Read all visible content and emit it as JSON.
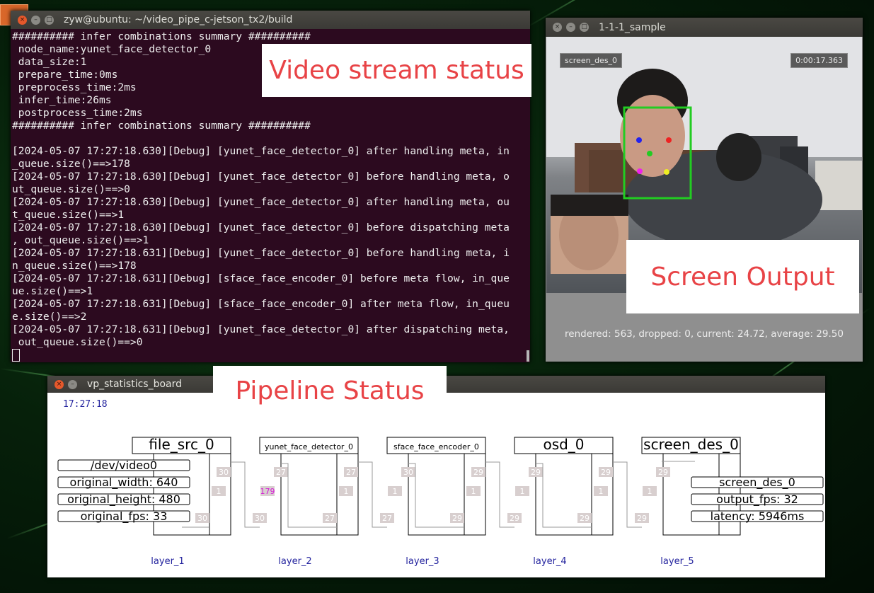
{
  "terminal": {
    "title": "zyw@ubuntu: ~/video_pipe_c-jetson_tx2/build",
    "lines": [
      "########## infer combinations summary ##########",
      " node_name:yunet_face_detector_0",
      " data_size:1",
      " prepare_time:0ms",
      " preprocess_time:2ms",
      " infer_time:26ms",
      " postprocess_time:2ms",
      "########## infer combinations summary ##########",
      "",
      "[2024-05-07 17:27:18.630][Debug] [yunet_face_detector_0] after handling meta, in",
      "_queue.size()==>178",
      "[2024-05-07 17:27:18.630][Debug] [yunet_face_detector_0] before handling meta, o",
      "ut_queue.size()==>0",
      "[2024-05-07 17:27:18.630][Debug] [yunet_face_detector_0] after handling meta, ou",
      "t_queue.size()==>1",
      "[2024-05-07 17:27:18.630][Debug] [yunet_face_detector_0] before dispatching meta",
      ", out_queue.size()==>1",
      "[2024-05-07 17:27:18.631][Debug] [yunet_face_detector_0] before handling meta, i",
      "n_queue.size()==>178",
      "[2024-05-07 17:27:18.631][Debug] [sface_face_encoder_0] before meta flow, in_que",
      "ue.size()==>1",
      "[2024-05-07 17:27:18.631][Debug] [sface_face_encoder_0] after meta flow, in_queu",
      "e.size()==>2",
      "[2024-05-07 17:27:18.631][Debug] [yunet_face_detector_0] after dispatching meta,",
      " out_queue.size()==>0"
    ]
  },
  "annotations": {
    "video_stream": "Video stream status",
    "screen_output": "Screen Output",
    "pipeline_status": "Pipeline Status"
  },
  "sample": {
    "title": "1-1-1_sample",
    "tag_left": "screen_des_0",
    "tag_right": "0:00:17.363",
    "stats": "rendered: 563, dropped: 0, current: 24.72, average: 29.50"
  },
  "board": {
    "title": "vp_statistics_board",
    "time": "17:27:18",
    "src_info": [
      "/dev/video0",
      "original_width: 640",
      "original_height: 480",
      "original_fps: 33"
    ],
    "des_info": [
      "screen_des_0",
      "output_fps: 32",
      "latency: 5946ms"
    ],
    "nodes": [
      {
        "name": "file_src_0",
        "layer": "layer_1",
        "in_val": "",
        "in_q": "",
        "out_q": "1",
        "out_val": "30",
        "out_in": "30"
      },
      {
        "name": "yunet_face_detector_0",
        "layer": "layer_2",
        "in_val": "27",
        "in_q": "179",
        "out_q": "1",
        "out_val": "27",
        "out_in": "27",
        "in_left": "30"
      },
      {
        "name": "sface_face_encoder_0",
        "layer": "layer_3",
        "in_val": "30",
        "in_q": "1",
        "out_q": "1",
        "out_val": "29",
        "out_in": "29",
        "in_left": "27"
      },
      {
        "name": "osd_0",
        "layer": "layer_4",
        "in_val": "29",
        "in_q": "1",
        "out_q": "1",
        "out_val": "29",
        "out_in": "29",
        "in_left": "29"
      },
      {
        "name": "screen_des_0",
        "layer": "layer_5",
        "in_val": "29",
        "in_q": "1",
        "out_q": "",
        "out_val": "",
        "out_in": "",
        "in_left": "29"
      }
    ]
  },
  "colors": {
    "annotation_text": "#e84346",
    "terminal_bg": "#2c0a1f",
    "board_text_blue": "#23239e",
    "queue_badge": "#d8cfcf",
    "queue_badge_text_hi": "#d61ad6"
  }
}
